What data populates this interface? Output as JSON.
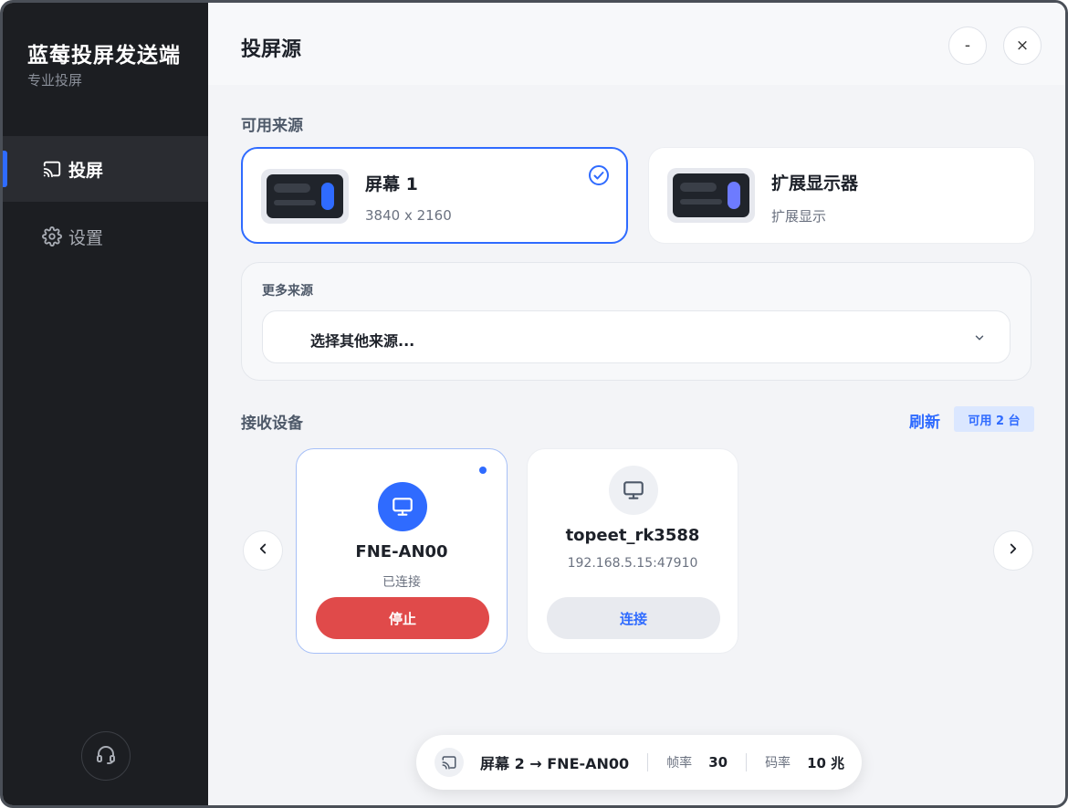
{
  "sidebar": {
    "title": "蓝莓投屏发送端",
    "subtitle": "专业投屏",
    "items": [
      {
        "label": "投屏",
        "icon": "cast-icon"
      },
      {
        "label": "设置",
        "icon": "gear-icon"
      }
    ]
  },
  "header": {
    "title": "投屏源",
    "minimize_label": "-",
    "close_label": "×"
  },
  "sources": {
    "section_label": "可用来源",
    "cards": [
      {
        "name": "屏幕 1",
        "detail": "3840 x 2160",
        "selected": true
      },
      {
        "name": "扩展显示器",
        "detail": "扩展显示",
        "selected": false
      }
    ],
    "more_label": "更多来源",
    "select_value": "选择其他来源..."
  },
  "devices": {
    "section_label": "接收设备",
    "refresh_label": "刷新",
    "available_badge": "可用 2 台",
    "list": [
      {
        "name": "FNE-AN00",
        "status": "已连接",
        "action": "停止"
      },
      {
        "name": "topeet_rk3588",
        "status": "192.168.5.15:47910",
        "action": "连接"
      }
    ]
  },
  "status_bar": {
    "route": "屏幕 2 → FNE-AN00",
    "fps_label": "帧率",
    "fps_value": "30",
    "bitrate_label": "码率",
    "bitrate_value": "10 兆"
  },
  "colors": {
    "accent": "#2f6bff",
    "stop": "#e04a4a",
    "sidebar_bg": "#1c1e22"
  }
}
